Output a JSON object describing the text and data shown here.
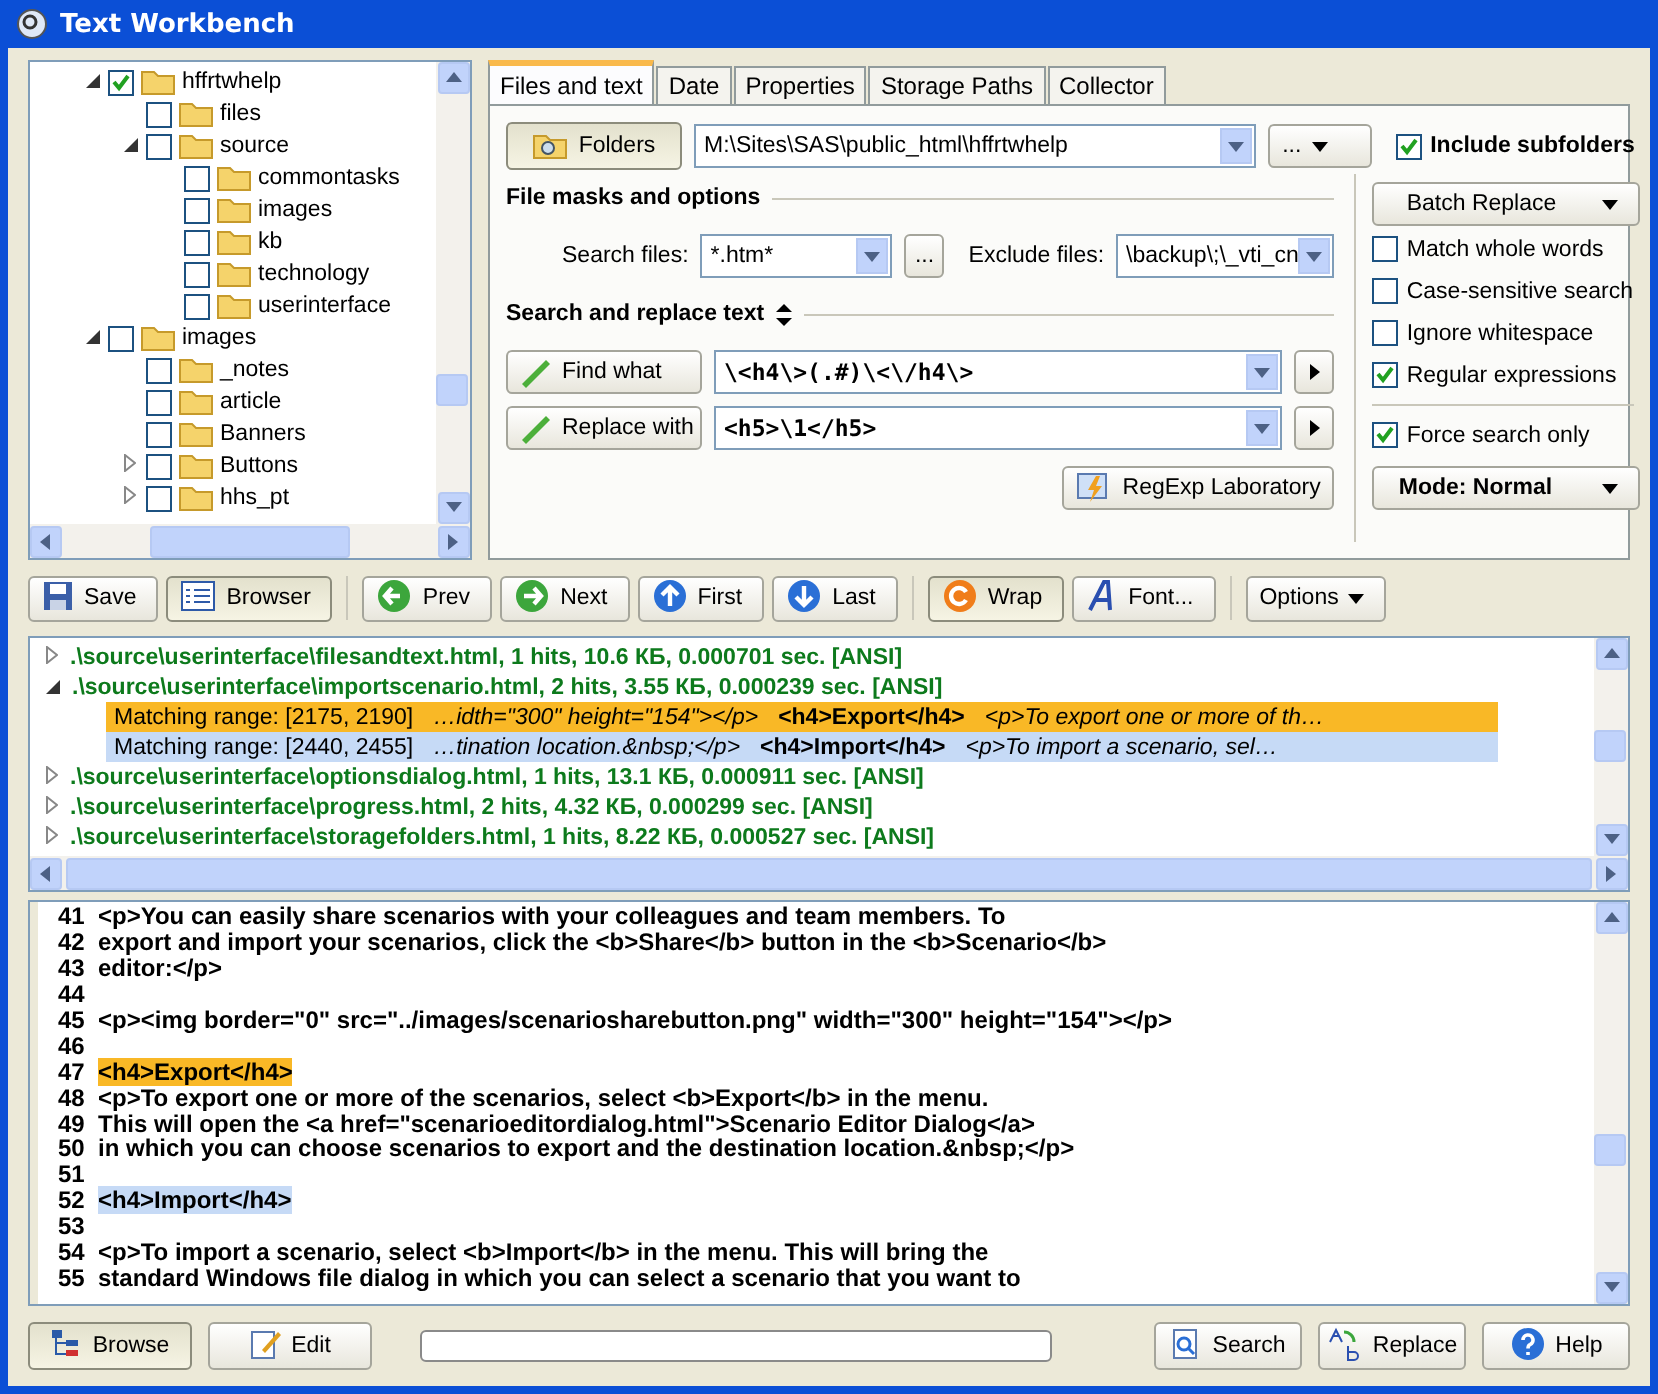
{
  "window": {
    "title": "Text Workbench"
  },
  "tree": [
    {
      "label": "hffrtwhelp",
      "checked": true,
      "expanded": true,
      "children": [
        {
          "label": "files",
          "checked": false
        },
        {
          "label": "source",
          "checked": false,
          "expanded": true,
          "children": [
            {
              "label": "commontasks",
              "checked": false
            },
            {
              "label": "images",
              "checked": false
            },
            {
              "label": "kb",
              "checked": false
            },
            {
              "label": "technology",
              "checked": false
            },
            {
              "label": "userinterface",
              "checked": false
            }
          ]
        }
      ]
    },
    {
      "label": "images",
      "checked": false,
      "expanded": true,
      "children": [
        {
          "label": "_notes",
          "checked": false
        },
        {
          "label": "article",
          "checked": false
        },
        {
          "label": "Banners",
          "checked": false
        },
        {
          "label": "Buttons",
          "checked": false,
          "expanded": false
        },
        {
          "label": "hhs_pt",
          "checked": false,
          "expanded": false
        }
      ]
    }
  ],
  "tabs": [
    {
      "label": "Files and text",
      "selected": true
    },
    {
      "label": "Date",
      "selected": false
    },
    {
      "label": "Properties",
      "selected": false
    },
    {
      "label": "Storage Paths",
      "selected": false
    },
    {
      "label": "Collector",
      "selected": false
    }
  ],
  "folders": {
    "button": "Folders",
    "path": "M:\\Sites\\SAS\\public_html\\hffrtwhelp",
    "browse": "...",
    "include_subfolders": {
      "label": "Include subfolders",
      "checked": true
    }
  },
  "file_masks": {
    "heading": "File masks and options",
    "search_label": "Search files:",
    "search_value": "*.htm*",
    "browse": "...",
    "exclude_label": "Exclude files:",
    "exclude_value": "\\backup\\;\\_vti_cn"
  },
  "search_replace": {
    "heading": "Search and replace text",
    "find_button": "Find what",
    "find_value": "\\<h4\\>(.#)\\<\\/h4\\>",
    "replace_button": "Replace with",
    "replace_value": "<h5>\\1</h5>",
    "regexp_button": "RegExp Laboratory"
  },
  "options": {
    "batch_button": "Batch Replace",
    "checks": [
      {
        "label": "Match whole words",
        "checked": false
      },
      {
        "label": "Case-sensitive search",
        "checked": false
      },
      {
        "label": "Ignore whitespace",
        "checked": false
      },
      {
        "label": "Regular expressions",
        "checked": true
      }
    ],
    "force": {
      "label": "Force search only",
      "checked": true
    },
    "mode_button": "Mode: Normal"
  },
  "toolbar": [
    {
      "label": "Save",
      "kind": "save",
      "selected": false
    },
    {
      "label": "Browser",
      "kind": "browser",
      "selected": true
    },
    {
      "label": "Prev",
      "kind": "prev",
      "selected": false
    },
    {
      "label": "Next",
      "kind": "next",
      "selected": false
    },
    {
      "label": "First",
      "kind": "first",
      "selected": false
    },
    {
      "label": "Last",
      "kind": "last",
      "selected": false
    },
    {
      "label": "Wrap",
      "kind": "wrap",
      "selected": true
    },
    {
      "label": "Font...",
      "kind": "font",
      "selected": false
    },
    {
      "label": "Options",
      "kind": "options",
      "selected": false
    }
  ],
  "results": [
    {
      "label": ".\\source\\userinterface\\filesandtext.html, 1 hits, 10.6 КБ, 0.000701 sec. [ANSI]",
      "expanded": false
    },
    {
      "label": ".\\source\\userinterface\\importscenario.html, 2 hits, 3.55 КБ, 0.000239 sec. [ANSI]",
      "expanded": true,
      "matches": [
        {
          "range": "Matching range: [2175, 2190]",
          "before": "…idth=\"300\" height=\"154\"></p>",
          "match": "<h4>Export</h4>",
          "after": "<p>To export one or more of th…",
          "current": true
        },
        {
          "range": "Matching range: [2440, 2455]",
          "before": "…tination location.&nbsp;</p>",
          "match": "<h4>Import</h4>",
          "after": "<p>To import a scenario, sel…",
          "current": false
        }
      ]
    },
    {
      "label": ".\\source\\userinterface\\optionsdialog.html, 1 hits, 13.1 КБ, 0.000911 sec. [ANSI]",
      "expanded": false
    },
    {
      "label": ".\\source\\userinterface\\progress.html, 2 hits, 4.32 КБ, 0.000299 sec. [ANSI]",
      "expanded": false
    },
    {
      "label": ".\\source\\userinterface\\storagefolders.html, 1 hits, 8.22 КБ, 0.000527 sec. [ANSI]",
      "expanded": false
    }
  ],
  "editor": [
    {
      "number": "41",
      "text": "<p>You can easily share scenarios with your colleagues and team members. To"
    },
    {
      "number": "42",
      "text": "export and import your scenarios, click the <b>Share</b> button in the <b>Scenario</b>"
    },
    {
      "number": "43",
      "text": "editor:</p>"
    },
    {
      "number": "44"
    },
    {
      "number": "45",
      "text": "<p><img border=\"0\" src=\"../images/scenariosharebutton.png\" width=\"300\" height=\"154\"></p>"
    },
    {
      "number": "46"
    },
    {
      "number": "47",
      "text": "<h4>Export</h4>",
      "current": true
    },
    {
      "number": "48",
      "text": "<p>To export one or more of the scenarios, select <b>Export</b> in the menu."
    },
    {
      "number": "49",
      "text": "This will open the <a href=\"scenarioeditordialog.html\">Scenario Editor Dialog</a>"
    },
    {
      "number": "50",
      "text": "in which you can choose scenarios to export and the destination location.&nbsp;</p>"
    },
    {
      "number": "51"
    },
    {
      "number": "52",
      "text": "<h4>Import</h4>",
      "current": false
    },
    {
      "number": "53"
    },
    {
      "number": "54",
      "text": "<p>To import a scenario, select <b>Import</b> in the menu. This will bring the"
    },
    {
      "number": "55",
      "text": "standard Windows file dialog in which you can select a scenario that you want to"
    }
  ],
  "bottom": {
    "buttons": [
      {
        "label": "Browse",
        "kind": "browse",
        "selected": true
      },
      {
        "label": "Edit",
        "kind": "edit",
        "selected": false
      }
    ],
    "progress": {
      "level": 0
    },
    "actions": [
      {
        "label": "Search",
        "kind": "search"
      },
      {
        "label": "Replace",
        "kind": "replace"
      },
      {
        "label": "Help",
        "kind": "help"
      }
    ]
  }
}
